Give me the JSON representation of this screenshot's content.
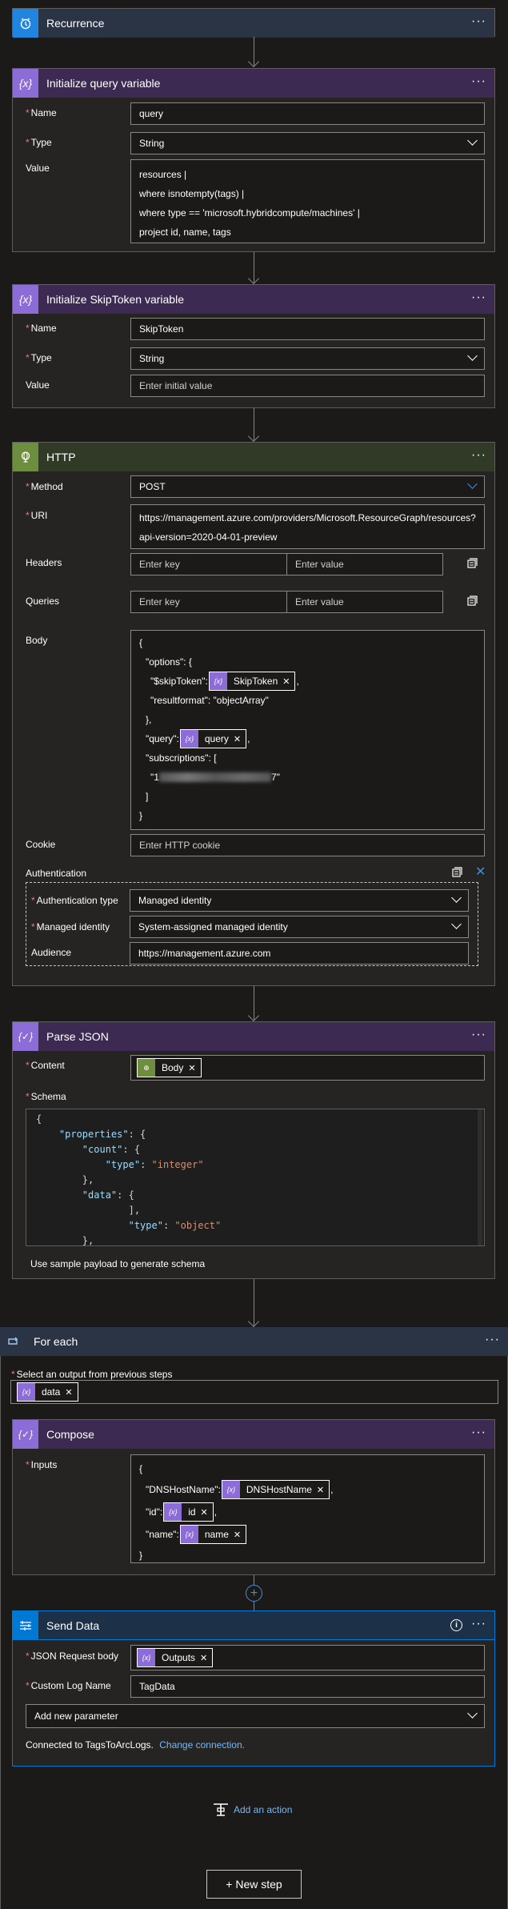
{
  "recurrence": {
    "title": "Recurrence"
  },
  "init_query": {
    "title": "Initialize query variable",
    "name_label": "Name",
    "name_value": "query",
    "type_label": "Type",
    "type_value": "String",
    "value_label": "Value",
    "value_lines": [
      "resources |",
      "where isnotempty(tags) |",
      "where type == 'microsoft.hybridcompute/machines' |",
      "project id, name, tags"
    ]
  },
  "init_skip": {
    "title": "Initialize SkipToken variable",
    "name_label": "Name",
    "name_value": "SkipToken",
    "type_label": "Type",
    "type_value": "String",
    "value_label": "Value",
    "value_placeholder": "Enter initial value"
  },
  "http": {
    "title": "HTTP",
    "method_label": "Method",
    "method_value": "POST",
    "uri_label": "URI",
    "uri_lines": [
      "https://management.azure.com/providers/Microsoft.ResourceGraph/resources?",
      "api-version=2020-04-01-preview"
    ],
    "headers_label": "Headers",
    "queries_label": "Queries",
    "key_placeholder": "Enter key",
    "value_placeholder": "Enter value",
    "body_label": "Body",
    "body": {
      "l1": "{",
      "l2": "\"options\": {",
      "l3": "\"$skipToken\":",
      "l3_token": "SkipToken",
      "l3_after": ",",
      "l4": "\"resultformat\": \"objectArray\"",
      "l5": "},",
      "l6": "\"query\":",
      "l6_token": "query",
      "l6_after": ",",
      "l7": "\"subscriptions\": [",
      "l8_pre": "\"1",
      "l8_post": "7\"",
      "l9": "]",
      "l10": "}"
    },
    "cookie_label": "Cookie",
    "cookie_placeholder": "Enter HTTP cookie",
    "auth_label": "Authentication",
    "auth_type_label": "Authentication type",
    "auth_type_value": "Managed identity",
    "managed_identity_label": "Managed identity",
    "managed_identity_value": "System-assigned managed identity",
    "audience_label": "Audience",
    "audience_value": "https://management.azure.com"
  },
  "parse_json": {
    "title": "Parse JSON",
    "content_label": "Content",
    "content_token": "Body",
    "schema_label": "Schema",
    "schema_lines": [
      {
        "indent": "",
        "text": "{"
      },
      {
        "indent": "    ",
        "key": "\"properties\"",
        "rest": ": {"
      },
      {
        "indent": "        ",
        "key": "\"count\"",
        "rest": ": {"
      },
      {
        "indent": "            ",
        "key": "\"type\"",
        "rest": ": ",
        "str": "\"integer\""
      },
      {
        "indent": "        ",
        "text": "},"
      },
      {
        "indent": "        ",
        "key": "\"data\"",
        "rest": ": {"
      },
      {
        "indent": "                ",
        "text": "],"
      },
      {
        "indent": "                ",
        "key": "\"type\"",
        "rest": ": ",
        "str": "\"object\""
      },
      {
        "indent": "        ",
        "text": "},"
      }
    ],
    "sample_link": "Use sample payload to generate schema"
  },
  "for_each": {
    "title": "For each",
    "select_label": "Select an output from previous steps",
    "select_token": "data"
  },
  "compose": {
    "title": "Compose",
    "inputs_label": "Inputs",
    "l1": "{",
    "l2": "\"DNSHostName\":",
    "l2_token": "DNSHostName",
    "l2_after": ",",
    "l3": "\"id\":",
    "l3_token": "id",
    "l3_after": ",",
    "l4": "\"name\":",
    "l4_token": "name",
    "l5": "}"
  },
  "send_data": {
    "title": "Send Data",
    "json_label": "JSON Request body",
    "json_token": "Outputs",
    "log_label": "Custom Log Name",
    "log_value": "TagData",
    "add_param": "Add new parameter",
    "connected_text": "Connected to TagsToArcLogs.",
    "change_link": "Change connection."
  },
  "add_action": "Add an action",
  "new_step": "+ New step",
  "colors": {
    "purple": "#8c6cd6",
    "green": "#6d8e3e",
    "blue": "#0078d4",
    "link": "#3c8ee6"
  }
}
